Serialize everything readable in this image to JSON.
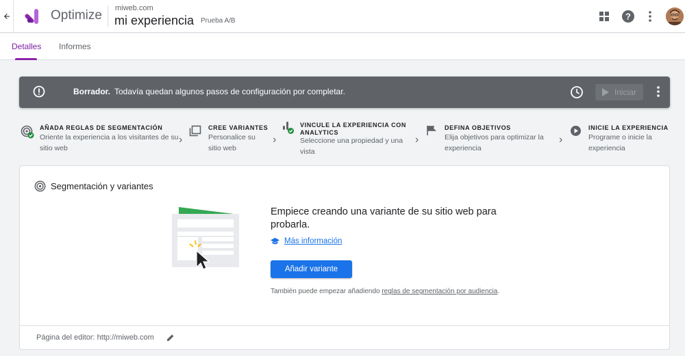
{
  "header": {
    "app_name": "Optimize",
    "site": "miweb.com",
    "experience_name": "mi experiencia",
    "experience_type": "Prueba A/B",
    "icons": [
      "arrow-back-icon",
      "optimize-logo",
      "apps-grid-icon",
      "help-icon",
      "more-vert-icon",
      "avatar"
    ]
  },
  "tabs": [
    {
      "label": "Detalles",
      "active": true
    },
    {
      "label": "Informes",
      "active": false
    }
  ],
  "banner": {
    "title": "Borrador.",
    "message": "Todavía quedan algunos pasos de configuración por completar.",
    "start_label": "Iniciar"
  },
  "steps": [
    {
      "title": "AÑADA REGLAS DE SEGMENTACIÓN",
      "desc": "Oriente la experiencia a los visitantes de su sitio web",
      "icon": "target-check-icon"
    },
    {
      "title": "CREE VARIANTES",
      "desc": "Personalice su sitio web",
      "icon": "variants-icon"
    },
    {
      "title": "VINCULE LA EXPERIENCIA CON ANALYTICS",
      "desc": "Seleccione una propiedad y una vista",
      "icon": "analytics-check-icon"
    },
    {
      "title": "DEFINA OBJETIVOS",
      "desc": "Elija objetivos para optimizar la experiencia",
      "icon": "flag-icon"
    },
    {
      "title": "INICIE LA EXPERIENCIA",
      "desc": "Programe o inicie la experiencia",
      "icon": "play-circle-icon"
    }
  ],
  "card": {
    "title": "Segmentación y variantes",
    "cta_title": "Empiece creando una variante de su sitio web para probarla.",
    "more_info": "Más información",
    "add_variant": "Añadir variante",
    "alt_prefix": "También puede empezar añadiendo ",
    "alt_link": "reglas de segmentación por audiencia",
    "alt_suffix": ".",
    "editor_page": "Página del editor: http://miweb.com"
  },
  "colors": {
    "accent": "#8e24aa",
    "primary_button": "#1a73e8",
    "banner_bg": "#5f6368",
    "check_green": "#1e8e3e"
  }
}
